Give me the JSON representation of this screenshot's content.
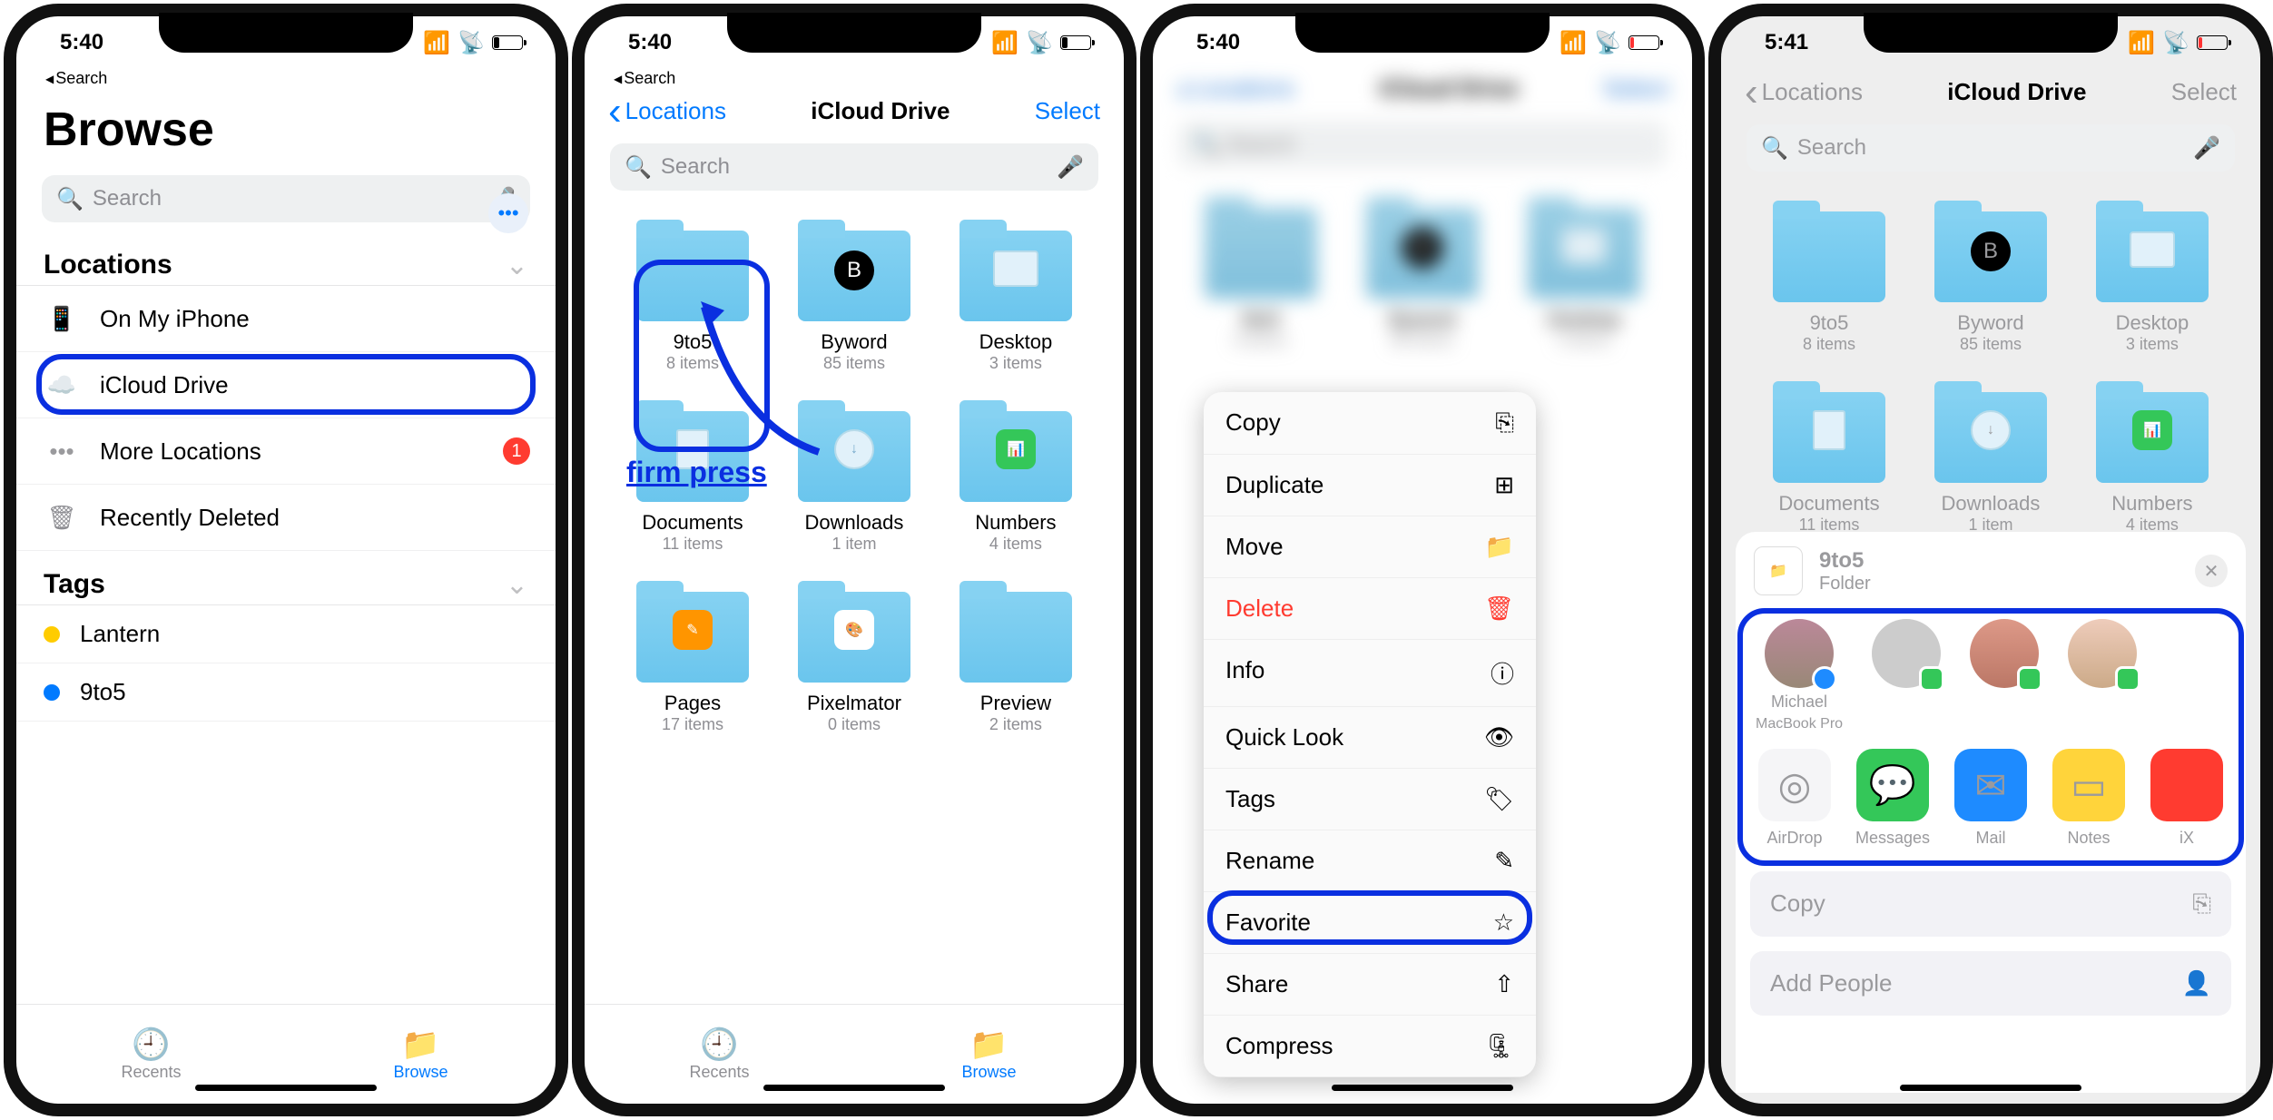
{
  "status": {
    "time1": "5:40",
    "time2": "5:40",
    "time3": "5:40",
    "time4": "5:41"
  },
  "back_search": "Search",
  "screens": {
    "browse_title": "Browse",
    "search_placeholder": "Search",
    "locations_header": "Locations",
    "loc_on_my_iphone": "On My iPhone",
    "loc_icloud": "iCloud Drive",
    "loc_more": "More Locations",
    "loc_more_badge": "1",
    "loc_deleted": "Recently Deleted",
    "tags_header": "Tags",
    "tag_lantern": "Lantern",
    "tag_9to5": "9to5",
    "nav_locations": "Locations",
    "nav_icloud": "iCloud Drive",
    "nav_select": "Select",
    "folders": [
      {
        "name": "9to5",
        "count": "8 items"
      },
      {
        "name": "Byword",
        "count": "85 items"
      },
      {
        "name": "Desktop",
        "count": "3 items"
      },
      {
        "name": "Documents",
        "count": "11 items"
      },
      {
        "name": "Downloads",
        "count": "1 item"
      },
      {
        "name": "Numbers",
        "count": "4 items"
      },
      {
        "name": "Pages",
        "count": "17 items"
      },
      {
        "name": "Pixelmator",
        "count": "0 items"
      },
      {
        "name": "Preview",
        "count": "2 items"
      }
    ],
    "annotation_firm_press": "firm press",
    "context_menu": [
      {
        "label": "Copy",
        "icon": "⎘"
      },
      {
        "label": "Duplicate",
        "icon": "⊞"
      },
      {
        "label": "Move",
        "icon": "📁"
      },
      {
        "label": "Delete",
        "icon": "🗑",
        "red": true
      },
      {
        "label": "Info",
        "icon": "ⓘ"
      },
      {
        "label": "Quick Look",
        "icon": "👁"
      },
      {
        "label": "Tags",
        "icon": "🏷"
      },
      {
        "label": "Rename",
        "icon": "✎"
      },
      {
        "label": "Favorite",
        "icon": "☆"
      },
      {
        "label": "Share",
        "icon": "⇧"
      },
      {
        "label": "Compress",
        "icon": "🗜"
      }
    ],
    "share_item": "9to5",
    "share_item_kind": "Folder",
    "share_contact": "Michael",
    "share_contact_sub": "MacBook Pro",
    "share_apps": [
      {
        "label": "AirDrop",
        "color": "#f5f5f7",
        "fg": "#007aff",
        "glyph": "◎"
      },
      {
        "label": "Messages",
        "color": "#34c759",
        "glyph": "💬"
      },
      {
        "label": "Mail",
        "color": "#1e8bff",
        "glyph": "✉"
      },
      {
        "label": "Notes",
        "color": "#ffd43b",
        "glyph": "▭"
      },
      {
        "label": "iX",
        "color": "#ff3b30",
        "glyph": ""
      }
    ],
    "copy_action": "Copy",
    "add_people": "Add People",
    "tab_recents": "Recents",
    "tab_browse": "Browse"
  }
}
